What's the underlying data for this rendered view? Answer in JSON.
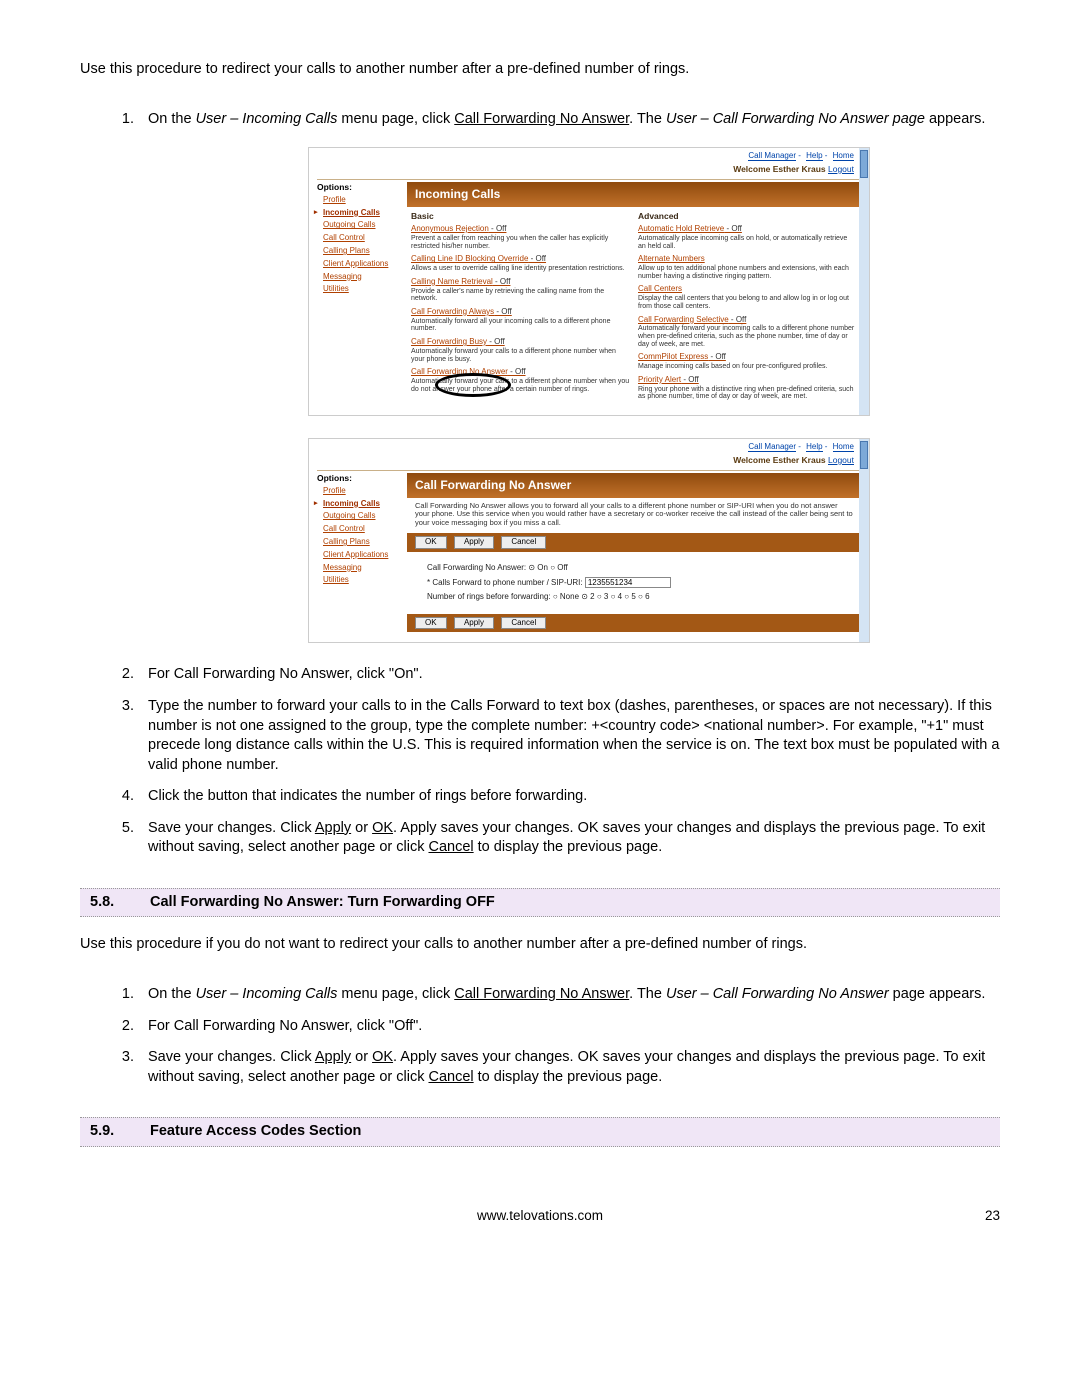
{
  "intro": "Use this procedure to redirect your calls to another number after a pre-defined number of rings.",
  "steps1": {
    "s1a": "On the ",
    "s1b": "User – Incoming Calls",
    "s1c": " menu page, click ",
    "s1d": "Call Forwarding No Answer",
    "s1e": ".  The ",
    "s1f": "User – Call Forwarding No Answer page",
    "s1g": " appears.",
    "s2": "For Call Forwarding No Answer, click \"On\".",
    "s3": "Type the number to forward your calls to in the Calls Forward to text box (dashes, parentheses, or spaces are not necessary).  If this number is not one assigned to the group, type the complete number:  +<country code> <national number>.  For example, \"+1\" must precede long distance calls within the U.S.  This is required information when the service is on.  The text box must be populated with a valid phone number.",
    "s4": "Click the button that indicates the number of rings before forwarding.",
    "s5a": "Save your changes.  Click ",
    "s5b": "Apply",
    "s5c": " or ",
    "s5d": "OK",
    "s5e": ".  Apply saves your changes. OK saves your changes and displays the previous page. To exit without saving, select another page or click ",
    "s5f": "Cancel",
    "s5g": " to display the previous page."
  },
  "section58": {
    "num": "5.8.",
    "title": "Call Forwarding No Answer: Turn Forwarding OFF"
  },
  "intro2": "Use this procedure if you do not want to redirect your calls to another number after a pre-defined number of rings.",
  "steps2": {
    "s1a": "On the ",
    "s1b": "User – Incoming Calls",
    "s1c": " menu page, click ",
    "s1d": "Call Forwarding No Answer",
    "s1e": ".  The ",
    "s1f": "User – Call Forwarding No Answer",
    "s1g": " page appears.",
    "s2": "For Call Forwarding No Answer, click \"Off\".",
    "s3a": "Save your changes.  Click ",
    "s3b": "Apply",
    "s3c": " or ",
    "s3d": "OK",
    "s3e": ".  Apply saves your changes. OK saves your changes and displays the previous page. To exit without saving, select another page or click ",
    "s3f": "Cancel",
    "s3g": " to display the previous page."
  },
  "section59": {
    "num": "5.9.",
    "title": "Feature Access Codes Section"
  },
  "footer": {
    "url": "www.telovations.com",
    "page": "23"
  },
  "shot1": {
    "toplinks": {
      "a": "Call Manager",
      "b": "Help",
      "c": "Home"
    },
    "welcome": "Welcome Esther Kraus ",
    "logout": "Logout",
    "options": "Options:",
    "menu": [
      "Profile",
      "Incoming Calls",
      "Outgoing Calls",
      "Call Control",
      "Calling Plans",
      "Client Applications",
      "Messaging",
      "Utilities"
    ],
    "title": "Incoming Calls",
    "colA": "Basic",
    "colB": "Advanced",
    "basic": [
      {
        "t": "Anonymous Rejection",
        "st": " - Off",
        "d": "Prevent a caller from reaching you when the caller has explicitly restricted his/her number."
      },
      {
        "t": "Calling Line ID Blocking Override",
        "st": " - Off",
        "d": "Allows a user to override calling line identity presentation restrictions."
      },
      {
        "t": "Calling Name Retrieval",
        "st": " - Off",
        "d": "Provide a caller's name by retrieving the calling name from the network."
      },
      {
        "t": "Call Forwarding Always",
        "st": " - Off",
        "d": "Automatically forward all your incoming calls to a different phone number."
      },
      {
        "t": "Call Forwarding Busy",
        "st": " - Off",
        "d": "Automatically forward your calls to a different phone number when your phone is busy."
      },
      {
        "t": "Call Forwarding No Answer",
        "st": " - Off",
        "d": "Automatically forward your calls to a different phone number when you do not answer your phone after a certain number of rings."
      }
    ],
    "adv": [
      {
        "t": "Automatic Hold Retrieve",
        "st": " - Off",
        "d": "Automatically place incoming calls on hold, or automatically retrieve an held call."
      },
      {
        "t": "Alternate Numbers",
        "st": "",
        "d": "Allow up to ten additional phone numbers and extensions, with each number having a distinctive ringing pattern."
      },
      {
        "t": "Call Centers",
        "st": "",
        "d": "Display the call centers that you belong to and allow log in or log out from those call centers."
      },
      {
        "t": "Call Forwarding Selective",
        "st": " - Off",
        "d": "Automatically forward your incoming calls to a different phone number when pre-defined criteria, such as the phone number, time of day or day of week, are met."
      },
      {
        "t": "CommPilot Express",
        "st": " - Off",
        "d": "Manage incoming calls based on four pre-configured profiles."
      },
      {
        "t": "Priority Alert",
        "st": " - Off",
        "d": "Ring your phone with a distinctive ring when pre-defined criteria, such as phone number, time of day or day of week, are met."
      }
    ]
  },
  "shot2": {
    "title": "Call Forwarding No Answer",
    "desc": "Call Forwarding No Answer allows you to forward all your calls to a different phone number or SIP-URI when you do not answer your phone. Use this service when you would rather have a secretary or co-worker receive the call instead of the caller being sent to your voice messaging box if you miss a call.",
    "btns": {
      "ok": "OK",
      "apply": "Apply",
      "cancel": "Cancel"
    },
    "form": {
      "l1": "Call Forwarding No Answer:  ⊙ On  ○ Off",
      "l2a": "* Calls Forward to phone number / SIP-URI: ",
      "l2b": "1235551234",
      "l3": "Number of rings before forwarding:  ○ None  ⊙ 2  ○ 3  ○ 4  ○ 5  ○ 6"
    }
  }
}
